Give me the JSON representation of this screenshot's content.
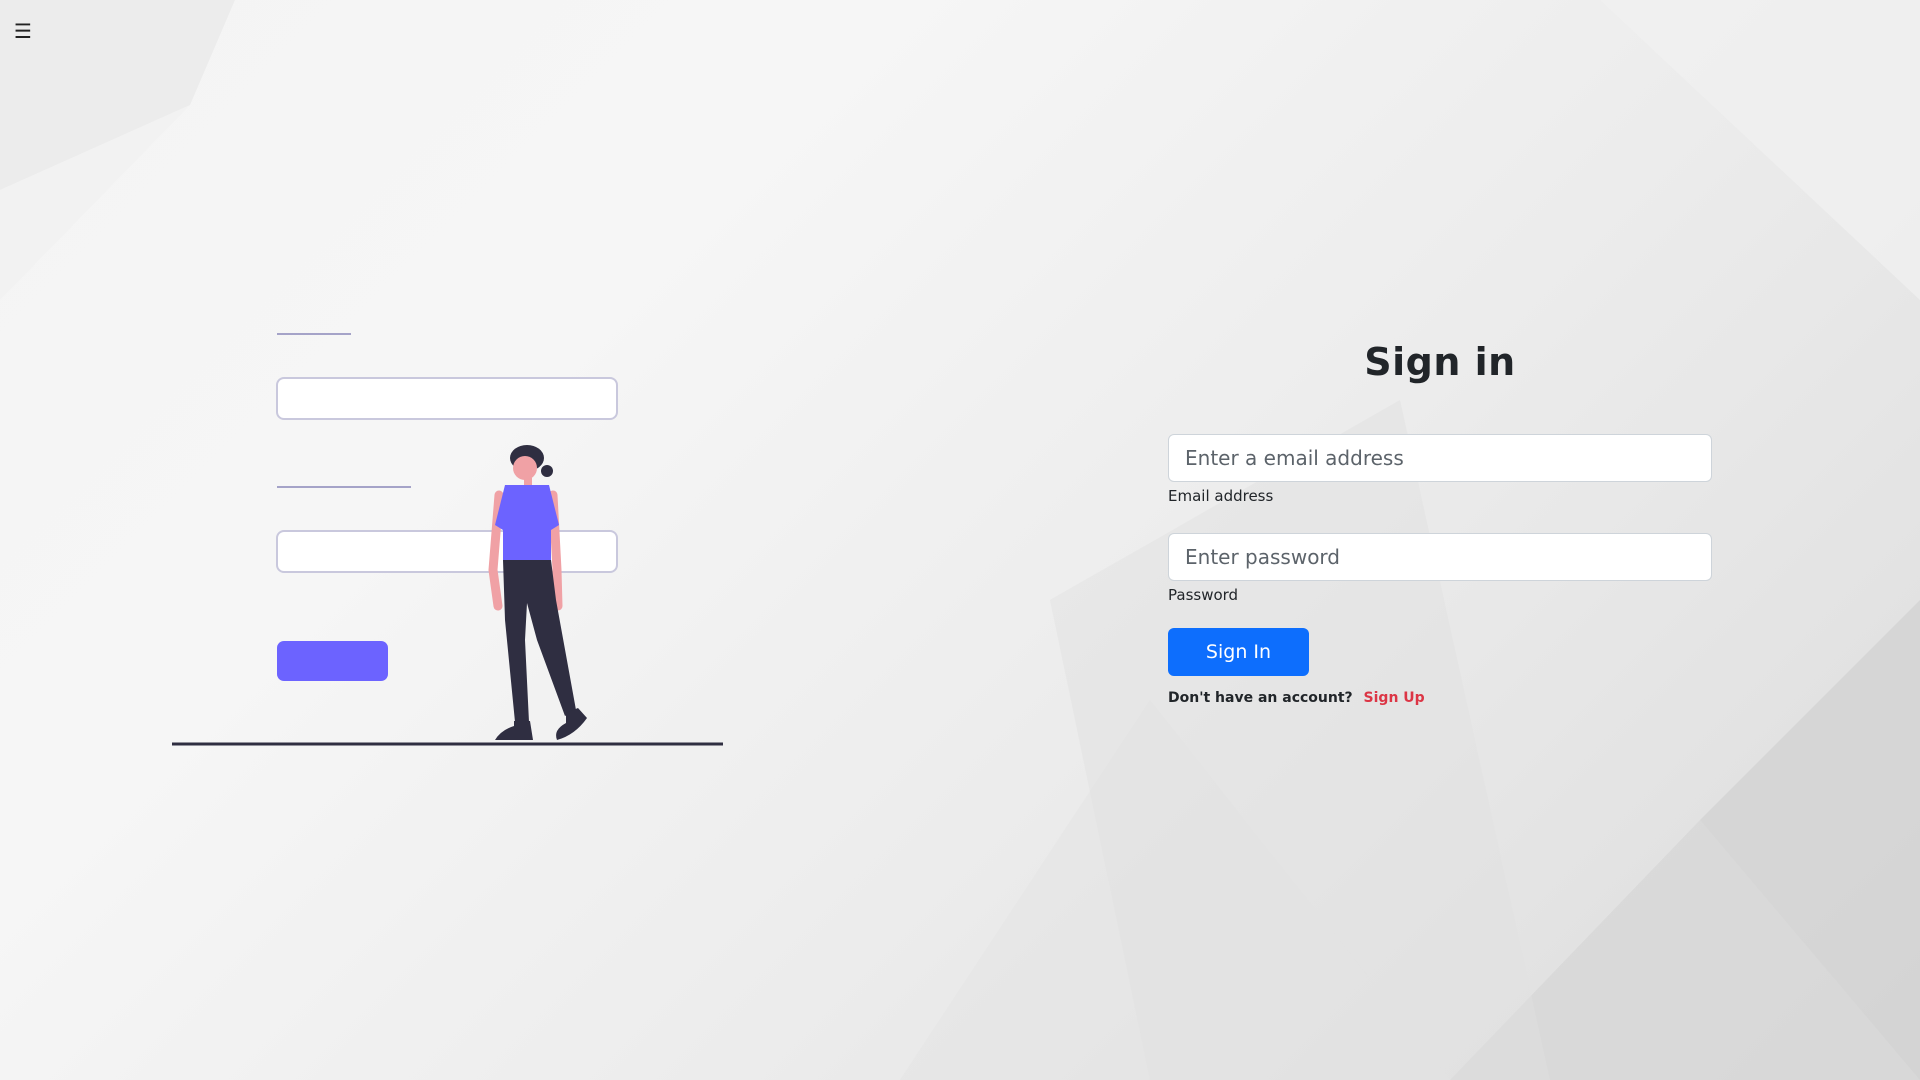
{
  "nav": {
    "menu_icon": "hamburger-menu-icon",
    "menu_glyph": "☰"
  },
  "signin": {
    "title": "Sign in",
    "email": {
      "placeholder": "Enter a email address",
      "value": "",
      "label": "Email address"
    },
    "password": {
      "placeholder": "Enter password",
      "value": "",
      "label": "Password"
    },
    "submit_label": "Sign In",
    "signup_prompt": "Don't have an account?",
    "signup_link": "Sign Up"
  },
  "colors": {
    "primary": "#0d6efd",
    "danger": "#dc3545",
    "illustration_accent": "#6c63ff",
    "illustration_dark": "#2f2e41",
    "skin": "#f0a1a5"
  }
}
